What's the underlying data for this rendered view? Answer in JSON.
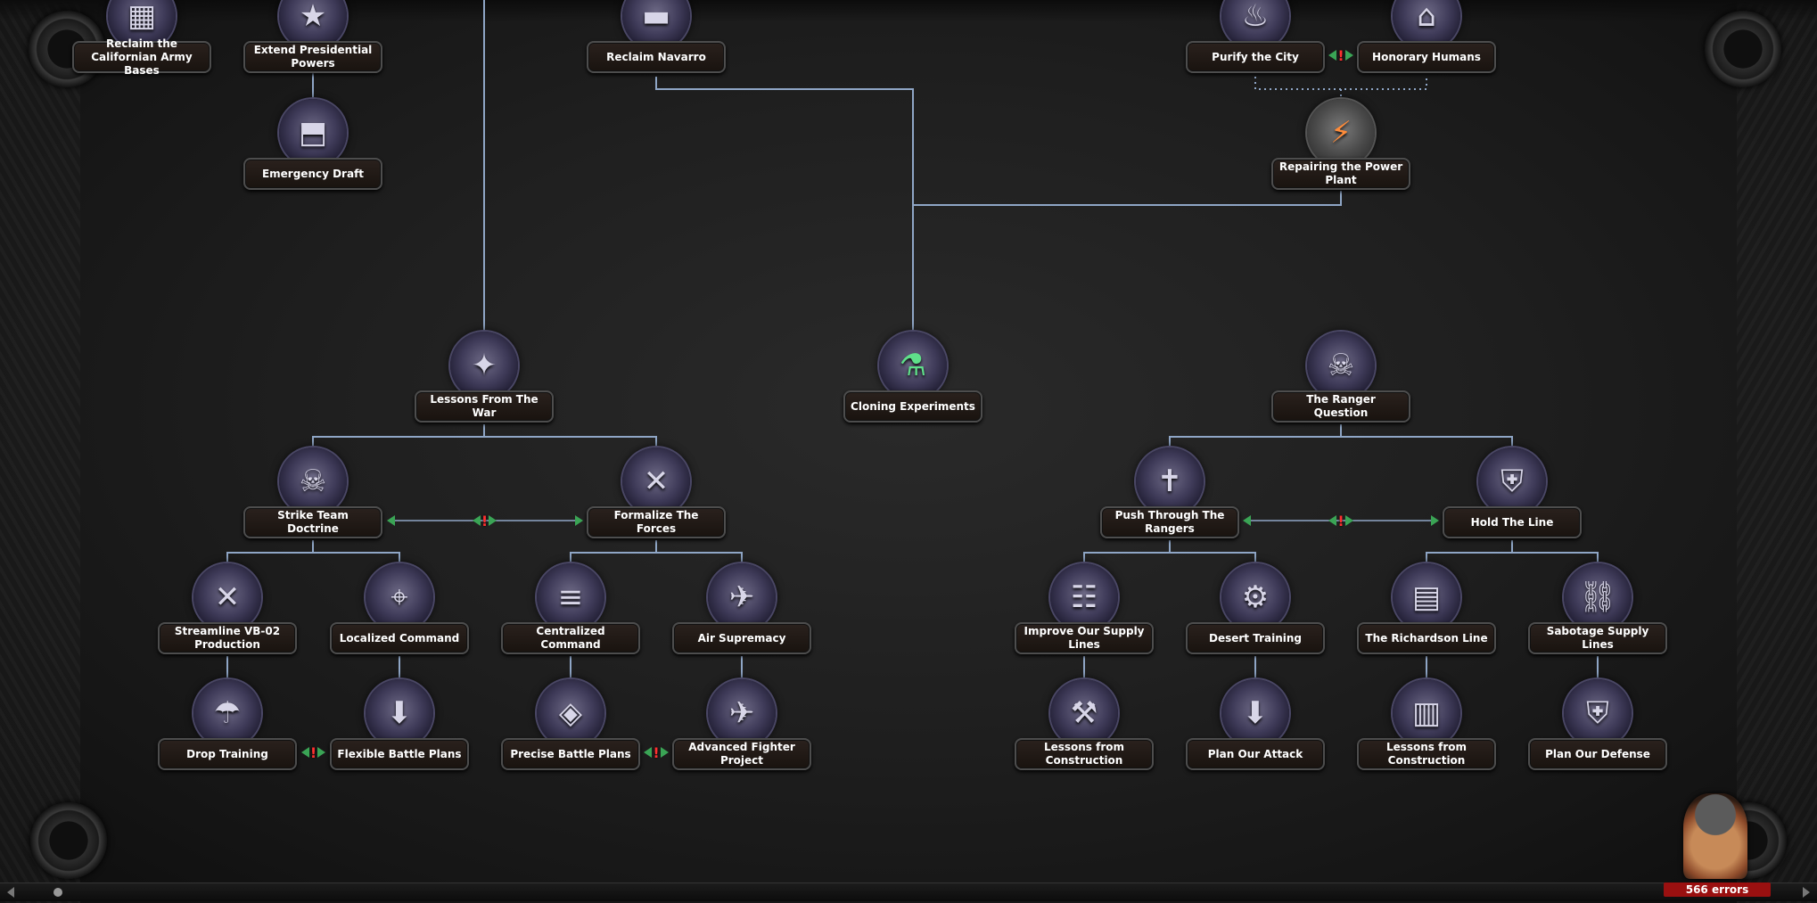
{
  "colors": {
    "connector": "#8fa6c6",
    "label_bg": "#21180f",
    "label_text": "#ffffff",
    "exclusive_arrow": "#3aa455",
    "exclusive_mark": "#ff3030",
    "error_bg": "#9a1010"
  },
  "focuses": [
    {
      "id": "reclaim-californian",
      "label": "Reclaim the Californian Army Bases",
      "icon": "crate-icon"
    },
    {
      "id": "extend-powers",
      "label": "Extend Presidential Powers",
      "icon": "presidential-seal-icon"
    },
    {
      "id": "emergency-draft",
      "label": "Emergency Draft",
      "icon": "draft-rank-icon"
    },
    {
      "id": "reclaim-navarro",
      "label": "Reclaim Navarro",
      "icon": "tank-icon"
    },
    {
      "id": "purify-city",
      "label": "Purify the City",
      "icon": "city-fire-icon"
    },
    {
      "id": "honorary-humans",
      "label": "Honorary Humans",
      "icon": "government-building-icon"
    },
    {
      "id": "power-plant",
      "label": "Repairing the Power Plant",
      "icon": "lightning-icon"
    },
    {
      "id": "lessons-war",
      "label": "Lessons From The War",
      "icon": "rocket-star-icon"
    },
    {
      "id": "cloning",
      "label": "Cloning Experiments",
      "icon": "cloning-vat-icon"
    },
    {
      "id": "ranger-question",
      "label": "The Ranger Question",
      "icon": "ranger-helmet-icon"
    },
    {
      "id": "strike-team",
      "label": "Strike Team Doctrine",
      "icon": "skull-wings-icon"
    },
    {
      "id": "formalize",
      "label": "Formalize The Forces",
      "icon": "crossed-rifles-icon"
    },
    {
      "id": "push-rangers",
      "label": "Push Through The Rangers",
      "icon": "sword-cross-icon"
    },
    {
      "id": "hold-line",
      "label": "Hold The Line",
      "icon": "shield-icon"
    },
    {
      "id": "streamline",
      "label": "Streamline VB-02 Production",
      "icon": "crossed-guns-icon"
    },
    {
      "id": "localized",
      "label": "Localized Command",
      "icon": "radio-tower-icon"
    },
    {
      "id": "centralized",
      "label": "Centralized Command",
      "icon": "command-rank-icon"
    },
    {
      "id": "air-supremacy",
      "label": "Air Supremacy",
      "icon": "aircraft-icon"
    },
    {
      "id": "supply-lines",
      "label": "Improve Our Supply Lines",
      "icon": "supply-ladder-icon"
    },
    {
      "id": "desert-training",
      "label": "Desert Training",
      "icon": "desert-gear-icon"
    },
    {
      "id": "richardson-line",
      "label": "The Richardson Line",
      "icon": "bunker-icon"
    },
    {
      "id": "sabotage",
      "label": "Sabotage Supply Lines",
      "icon": "broken-chain-icon"
    },
    {
      "id": "drop-training",
      "label": "Drop Training",
      "icon": "parachute-icon"
    },
    {
      "id": "flexible-plans",
      "label": "Flexible Battle Plans",
      "icon": "map-arrow-icon"
    },
    {
      "id": "precise-plans",
      "label": "Precise Battle Plans",
      "icon": "compass-map-icon"
    },
    {
      "id": "advanced-fighter",
      "label": "Advanced Fighter Project",
      "icon": "fighter-jet-icon"
    },
    {
      "id": "lessons-construction-1",
      "label": "Lessons from Construction",
      "icon": "construction-tools-icon"
    },
    {
      "id": "plan-attack",
      "label": "Plan Our Attack",
      "icon": "attack-map-icon"
    },
    {
      "id": "lessons-construction-2",
      "label": "Lessons from Construction",
      "icon": "construction-blueprint-icon"
    },
    {
      "id": "plan-defense",
      "label": "Plan Our Defense",
      "icon": "defense-shield-icon"
    }
  ],
  "exclusive_marks": [
    {
      "between": [
        "purify-city",
        "honorary-humans"
      ],
      "mark": "!"
    },
    {
      "between": [
        "strike-team",
        "formalize"
      ],
      "mark": "!"
    },
    {
      "between": [
        "push-rangers",
        "hold-line"
      ],
      "mark": "!"
    },
    {
      "between": [
        "drop-training",
        "flexible-plans"
      ],
      "mark": "!"
    },
    {
      "between": [
        "precise-plans",
        "advanced-fighter"
      ],
      "mark": "!"
    }
  ],
  "error_indicator": {
    "text": "566 errors",
    "icon": "soldier-portrait-icon"
  }
}
